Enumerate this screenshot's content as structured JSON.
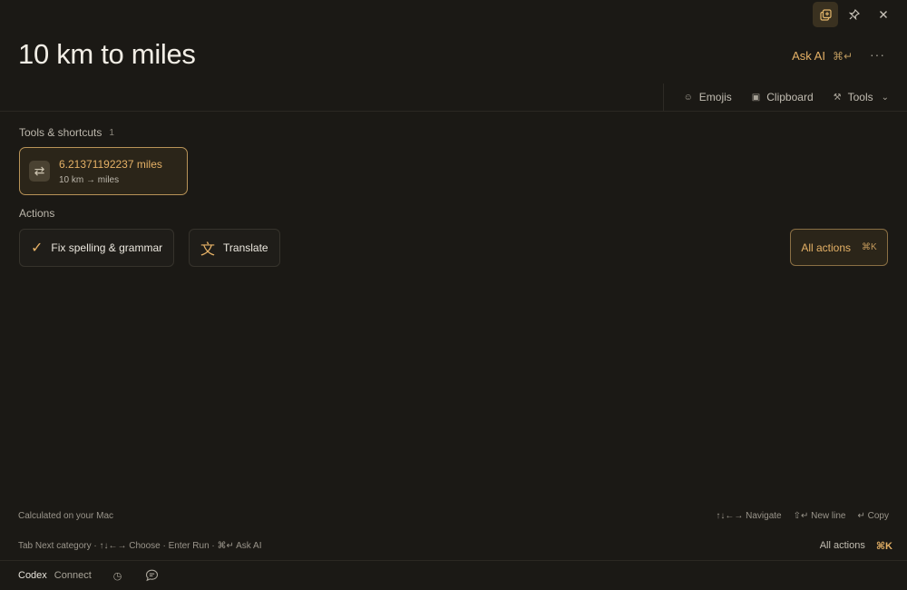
{
  "window": {
    "controls": [
      {
        "name": "float-window-icon",
        "glyph": "⧉"
      },
      {
        "name": "pin-icon",
        "glyph": "📌"
      },
      {
        "name": "close-icon",
        "glyph": "✕"
      }
    ]
  },
  "query": "10 km to miles",
  "header": {
    "ask_ai_label": "Ask AI",
    "ask_ai_shortcut": "⌘↵",
    "more_label": "···"
  },
  "filters": [
    {
      "label": "Emojis",
      "icon": "☺",
      "icon_name": "emoji-icon"
    },
    {
      "label": "Clipboard",
      "icon": "▣",
      "icon_name": "clipboard-icon"
    },
    {
      "label": "Tools",
      "icon": "⚒",
      "icon_name": "tools-icon",
      "dropdown": "⌄"
    }
  ],
  "tools_section": {
    "title": "Tools & shortcuts",
    "count": "1"
  },
  "result": {
    "icon": "⇄",
    "value": "6.21371192237 miles",
    "subtitle": "10 km → miles"
  },
  "actions_section": {
    "title": "Actions",
    "buttons": [
      {
        "label": "Fix spelling & grammar",
        "icon": "✓",
        "icon_name": "check-icon"
      },
      {
        "label": "Translate",
        "icon": "文",
        "icon_name": "translate-icon"
      }
    ],
    "all_actions_label": "All actions",
    "all_actions_shortcut": "⌘K"
  },
  "footer": {
    "calculated_note": "Calculated on your Mac",
    "hints": [
      {
        "label": "↑↓←→ Navigate"
      },
      {
        "label": "⇧↵ New line"
      },
      {
        "label": "↵ Copy"
      }
    ],
    "keyboard_help": "Tab Next category · ↑↓←→ Choose · Enter Run · ⌘↵ Ask AI",
    "all_actions_label": "All actions",
    "all_actions_shortcut": "⌘K"
  },
  "bottom_bar": {
    "codex_label": "Codex",
    "connect_label": "Connect",
    "history_icon": "◷",
    "chat_icon": "💬"
  },
  "colors": {
    "background": "#1b1915",
    "accent": "#e5b166"
  }
}
